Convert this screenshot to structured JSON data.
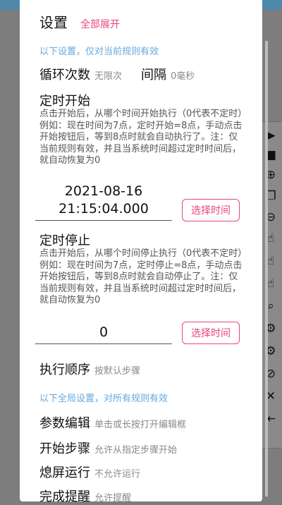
{
  "dialog": {
    "title": "设置",
    "expand_all": "全部展开"
  },
  "current_rule": {
    "hint": "以下设置，仅对当前规则有效",
    "loop_label": "循环次数",
    "loop_value": "无限次",
    "interval_label": "间隔",
    "interval_value": "0毫秒"
  },
  "timer_start": {
    "label": "定时开始",
    "desc": "点击开始后，从哪个时间开始执行（0代表不定时）例如：现在时间为7点，定时开始=8点，手动点击开始按钮后，等到8点时就会自动执行了。注：仅当前规则有效，并且当系统时间超过定时时间后，就自动恢复为0",
    "date": "2021-08-16",
    "time": "21:15:04.000",
    "button": "选择时间"
  },
  "timer_stop": {
    "label": "定时停止",
    "desc": "点击开始后，从哪个时间停止执行（0代表不定时）例如：现在时间为7点，定时停止=8点，手动点击开始按钮后，等到8点时就会自动停止了。注：仅当前规则有效，并且当系统时间超过定时时间后，就自动恢复为0",
    "value": "0",
    "button": "选择时间"
  },
  "order": {
    "label": "执行顺序",
    "value": "按默认步骤"
  },
  "global": {
    "hint": "以下全局设置，对所有规则有效",
    "param_label": "参数编辑",
    "param_value": "单击或长按打开编辑框",
    "start_label": "开始步骤",
    "start_value": "允许从指定步骤开始",
    "screen_label": "熄屏运行",
    "screen_value": "不允许运行",
    "done_label": "完成提醒",
    "done_value": "允许提醒"
  },
  "toolbar": {
    "icons": [
      "play-icon",
      "record-icon",
      "add-icon",
      "copy-icon",
      "remove-icon",
      "tap-icon",
      "swipe-icon",
      "hold-icon",
      "magnify-icon",
      "settings-icon",
      "gear-lock-icon",
      "hide-icon",
      "close-icon",
      "collapse-icon"
    ]
  }
}
